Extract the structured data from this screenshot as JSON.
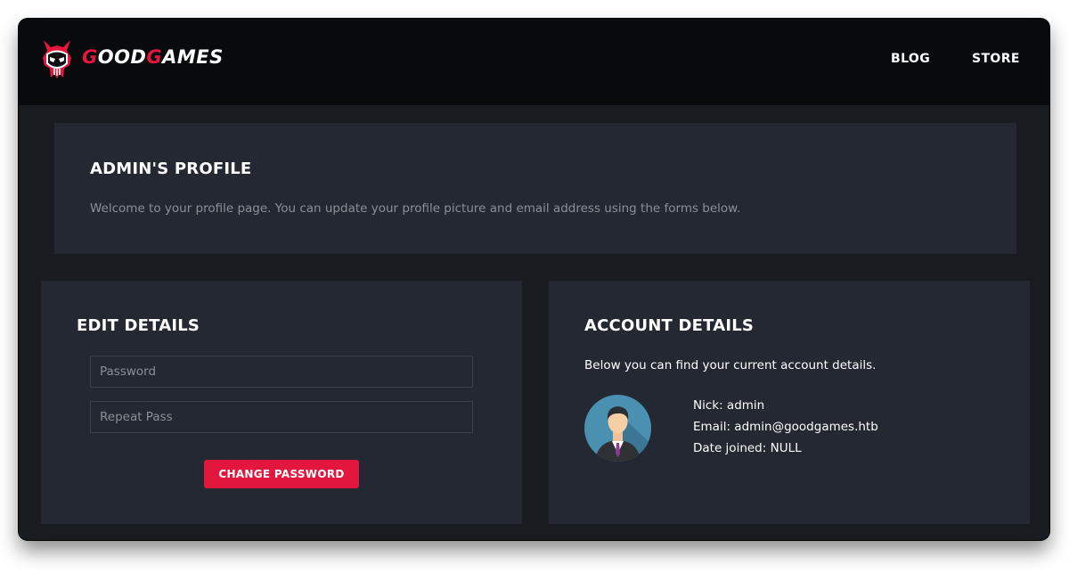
{
  "brand": {
    "prefix": "G",
    "mid": "OOD",
    "g2": "G",
    "suffix": "AMES"
  },
  "nav": {
    "blog": "BLOG",
    "store": "STORE"
  },
  "profile": {
    "title": "ADMIN'S PROFILE",
    "description": "Welcome to your profile page. You can update your profile picture and email address using the forms below."
  },
  "edit": {
    "title": "EDIT DETAILS",
    "password_placeholder": "Password",
    "repeat_placeholder": "Repeat Pass",
    "button_label": "CHANGE PASSWORD"
  },
  "account": {
    "title": "ACCOUNT DETAILS",
    "description": "Below you can find your current account details.",
    "nick": "Nick: admin",
    "email": "Email: admin@goodgames.htb",
    "date_joined": "Date joined: NULL"
  },
  "colors": {
    "accent": "#e3173e",
    "navbar_bg": "#080a0c",
    "page_bg": "#181c21",
    "panel_bg": "#232832"
  },
  "icons": {
    "logo": "demon-skull-logo",
    "avatar": "user-avatar-icon"
  }
}
